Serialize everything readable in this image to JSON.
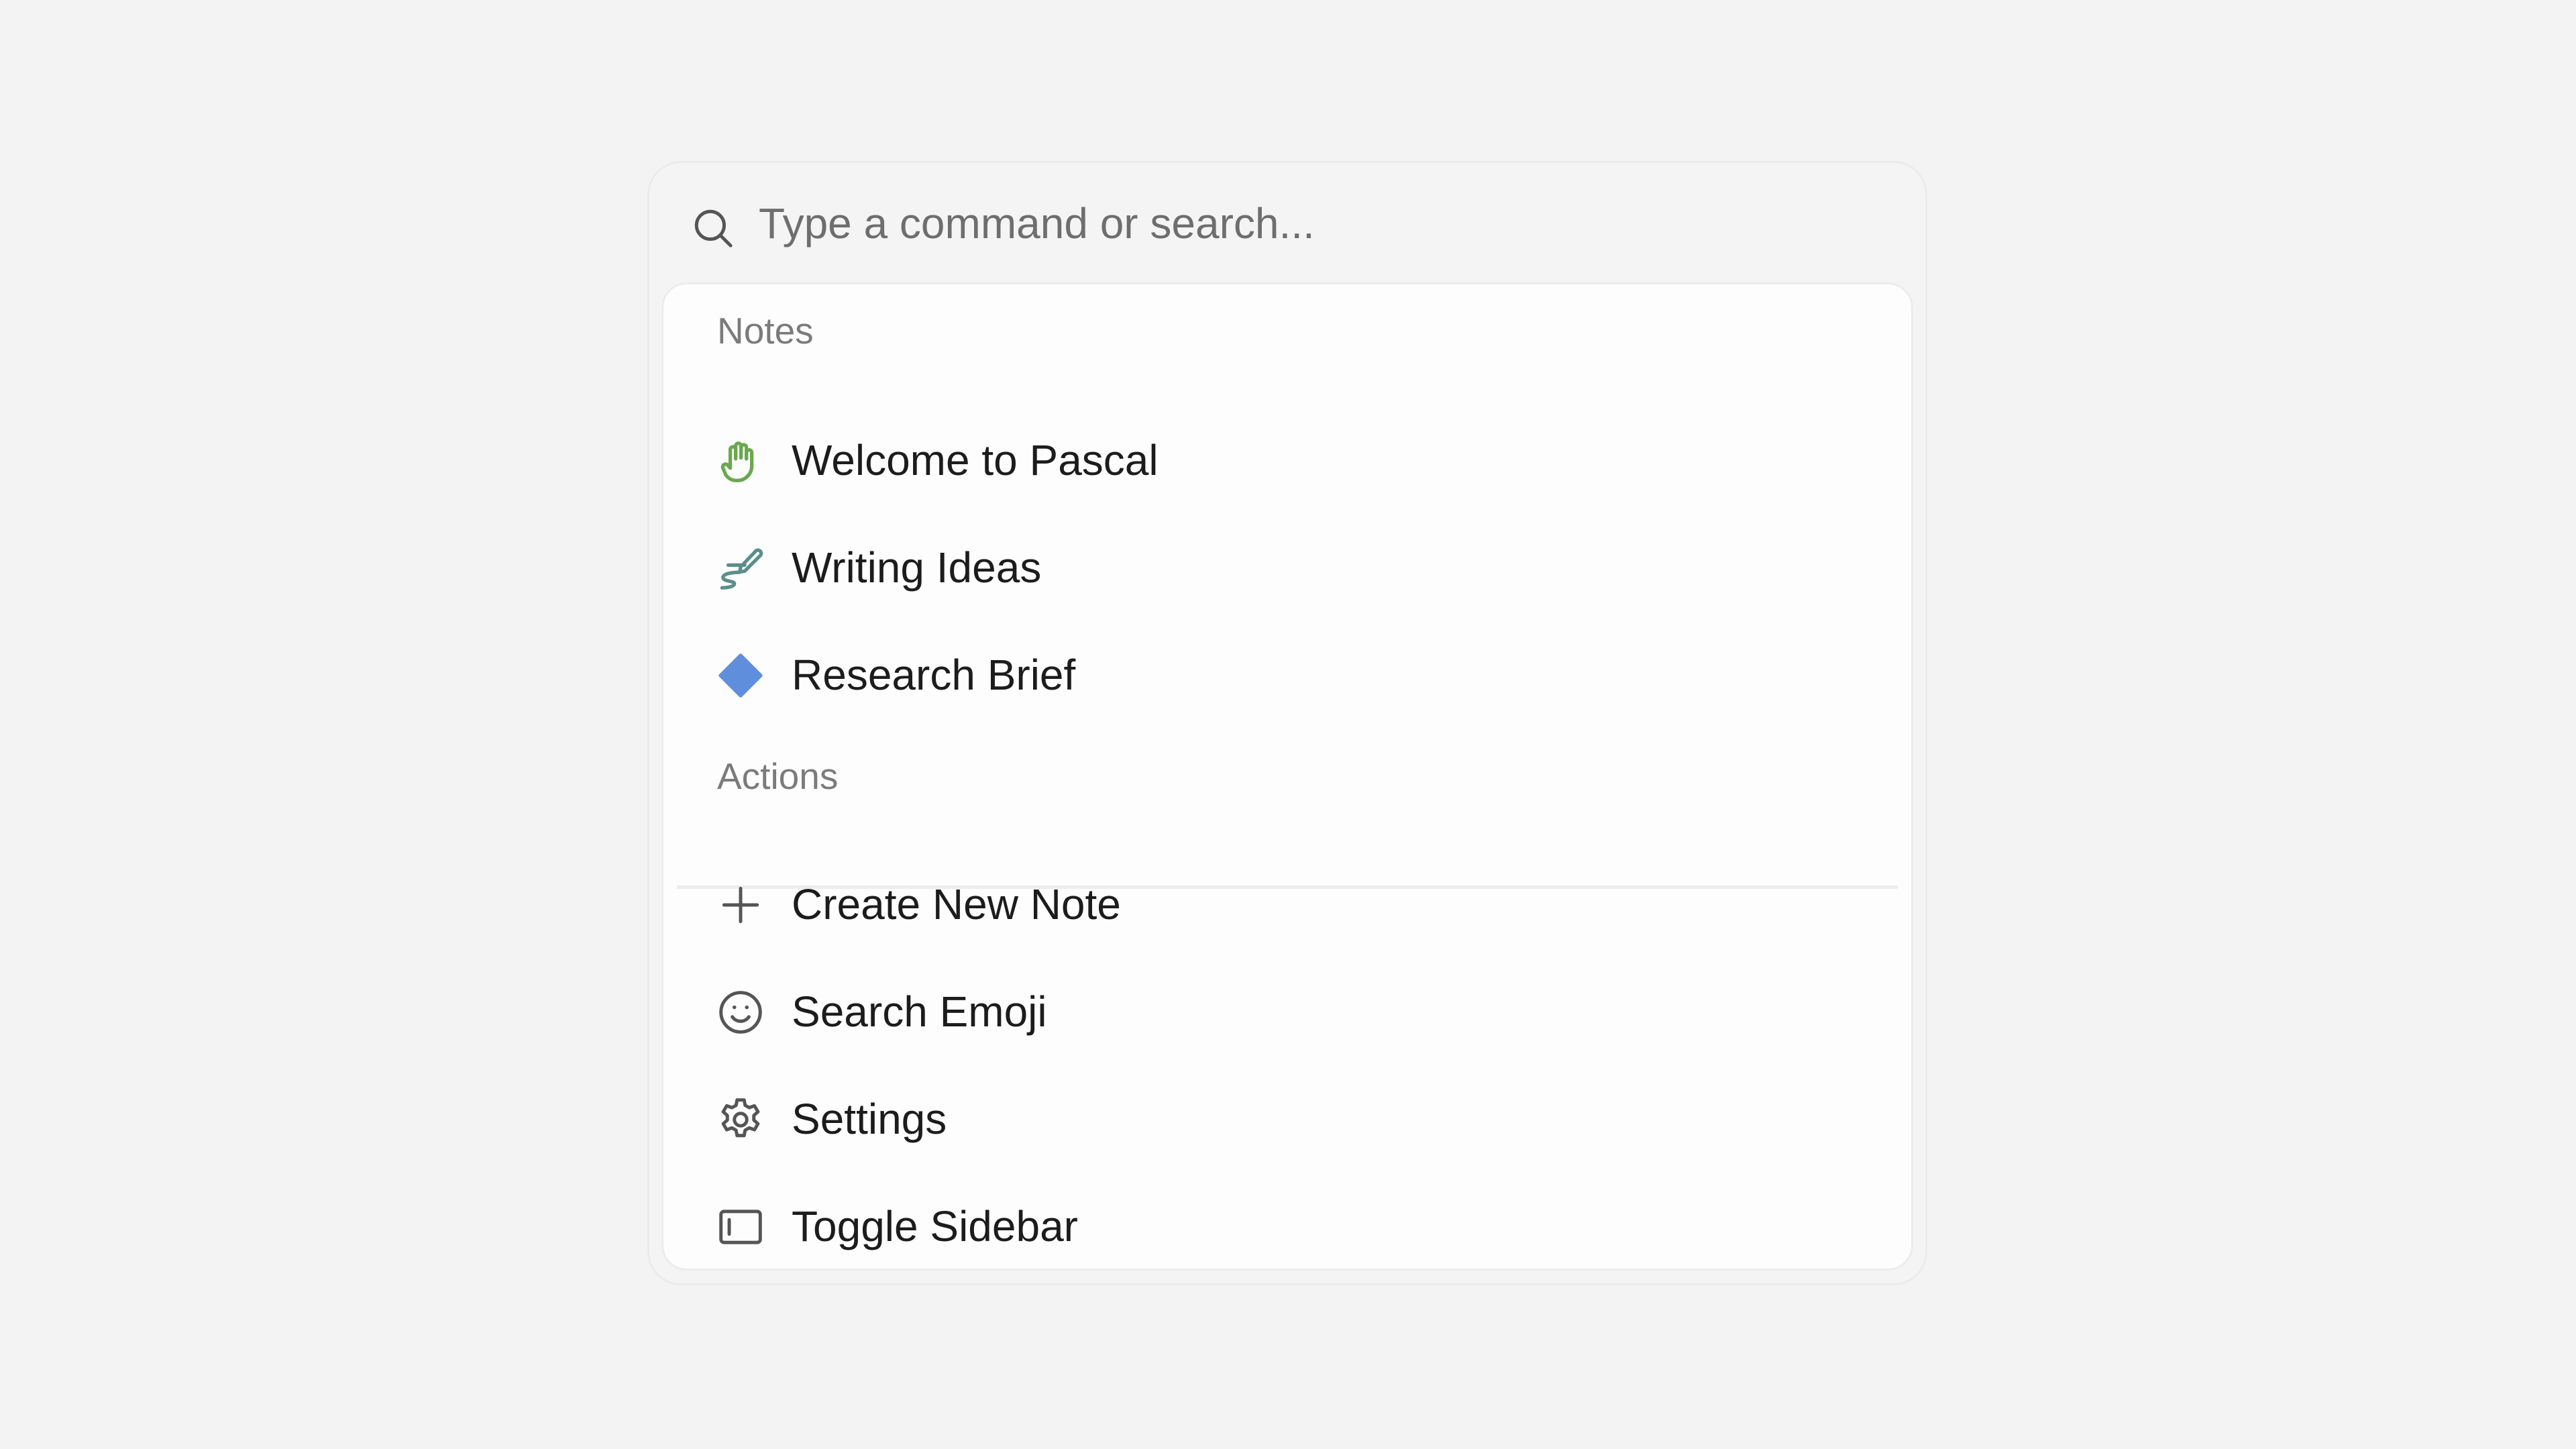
{
  "search": {
    "placeholder": "Type a command or search..."
  },
  "groups": [
    {
      "label": "Notes",
      "items": [
        {
          "label": "Welcome to Pascal",
          "icon": "hand-wave-icon",
          "color": "#6aa84f"
        },
        {
          "label": "Writing Ideas",
          "icon": "brush-icon",
          "color": "#5b8f8a"
        },
        {
          "label": "Research Brief",
          "icon": "diamond-icon",
          "color": "#5f8fdc"
        }
      ]
    },
    {
      "label": "Actions",
      "items": [
        {
          "label": "Create New Note",
          "icon": "plus-icon"
        },
        {
          "label": "Search Emoji",
          "icon": "smiley-icon"
        },
        {
          "label": "Settings",
          "icon": "gear-icon"
        },
        {
          "label": "Toggle Sidebar",
          "icon": "sidebar-icon"
        }
      ]
    }
  ],
  "colors": {
    "background": "#f3f3f3",
    "panel": "#fdfdfd",
    "text": "#1c1c1c",
    "muted": "#7b7b7b",
    "icon": "#555555"
  }
}
